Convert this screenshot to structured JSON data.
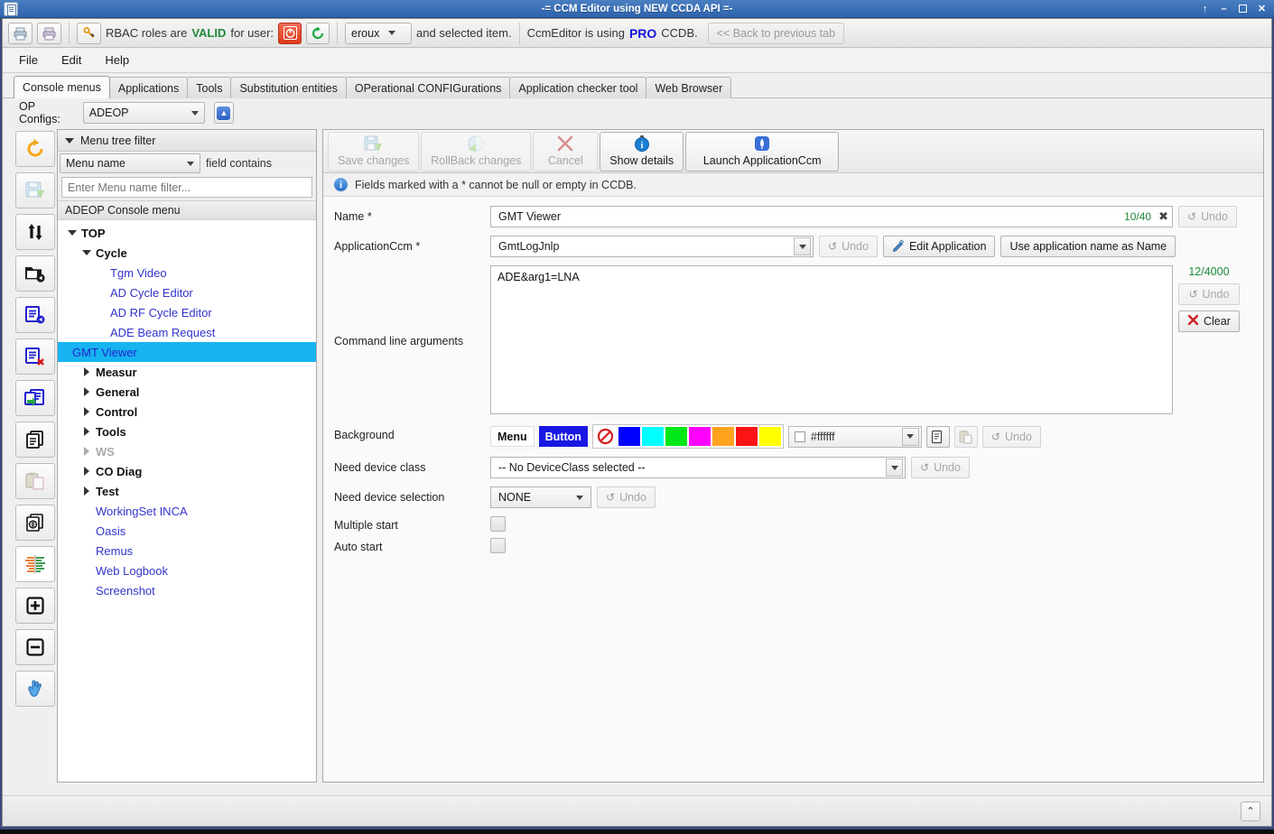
{
  "window": {
    "title": "-= CCM Editor using NEW CCDA API =-",
    "icon": "document-icon",
    "controls": [
      {
        "name": "roll-up-button",
        "glyph": "↑"
      },
      {
        "name": "minimize-button",
        "glyph": "–"
      },
      {
        "name": "maximize-button",
        "glyph": "□"
      },
      {
        "name": "close-button",
        "glyph": "✕"
      }
    ]
  },
  "rbac_bar": {
    "print_button": "print-icon",
    "print_preview_button": "print-preview-icon",
    "rbac_key_button": "rbac-key-icon",
    "text_prefix": "RBAC roles are",
    "status": "VALID",
    "for_user": "for user:",
    "logout_button": "power-off-icon",
    "refresh_button": "refresh-icon",
    "user": "eroux",
    "text_middle": "and selected item.",
    "text_app": "CcmEditor is using",
    "db_mode": "PRO",
    "text_suffix": "CCDB.",
    "back_button": "<< Back to previous tab"
  },
  "menubar": [
    "File",
    "Edit",
    "Help"
  ],
  "tabs": [
    {
      "label": "Console menus",
      "active": true
    },
    {
      "label": "Applications",
      "active": false
    },
    {
      "label": "Tools",
      "active": false
    },
    {
      "label": "Substitution entities",
      "active": false
    },
    {
      "label": "OPerational CONFIGurations",
      "active": false
    },
    {
      "label": "Application checker tool",
      "active": false
    },
    {
      "label": "Web Browser",
      "active": false
    }
  ],
  "opconfigs": {
    "label": "OP Configs:",
    "value": "ADEOP",
    "launch_button": "launch-app-icon"
  },
  "vtoolbar": [
    {
      "name": "reload-icon"
    },
    {
      "name": "save-disk-icon"
    },
    {
      "name": "move-updown-icon"
    },
    {
      "name": "new-folder-icon"
    },
    {
      "name": "add-entry-icon"
    },
    {
      "name": "delete-entry-icon"
    },
    {
      "name": "duplicate-entry-icon"
    },
    {
      "name": "copy-page-icon"
    },
    {
      "name": "paste-clipboard-icon"
    },
    {
      "name": "preview-pages-icon"
    },
    {
      "name": "compare-icon"
    },
    {
      "name": "expand-all-icon"
    },
    {
      "name": "collapse-all-icon"
    },
    {
      "name": "select-hand-icon"
    }
  ],
  "tree_panel": {
    "filter_header": "Menu tree filter",
    "filter_field": "Menu name",
    "field_contains": "field contains",
    "filter_placeholder": "Enter Menu name filter...",
    "tree_title": "ADEOP Console menu",
    "nodes": [
      {
        "label": "TOP",
        "depth": 0,
        "style": "bold",
        "arrow": "down"
      },
      {
        "label": "Cycle",
        "depth": 1,
        "style": "bold",
        "arrow": "down"
      },
      {
        "label": "Tgm Video",
        "depth": 2,
        "style": "link",
        "arrow": "none"
      },
      {
        "label": "AD Cycle  Editor",
        "depth": 2,
        "style": "link",
        "arrow": "none"
      },
      {
        "label": "AD RF Cycle Editor",
        "depth": 2,
        "style": "link",
        "arrow": "none"
      },
      {
        "label": "ADE Beam Request",
        "depth": 2,
        "style": "link",
        "arrow": "none"
      },
      {
        "label": "GMT Viewer",
        "depth": 2,
        "style": "selected",
        "arrow": "none"
      },
      {
        "label": "Measur",
        "depth": 1,
        "style": "bold",
        "arrow": "right"
      },
      {
        "label": "General",
        "depth": 1,
        "style": "bold",
        "arrow": "right"
      },
      {
        "label": "Control",
        "depth": 1,
        "style": "bold",
        "arrow": "right"
      },
      {
        "label": "Tools",
        "depth": 1,
        "style": "bold",
        "arrow": "right"
      },
      {
        "label": "WS",
        "depth": 1,
        "style": "dim",
        "arrow": "right-dim"
      },
      {
        "label": "CO Diag",
        "depth": 1,
        "style": "bold",
        "arrow": "right"
      },
      {
        "label": "Test",
        "depth": 1,
        "style": "bold",
        "arrow": "right"
      },
      {
        "label": "WorkingSet INCA",
        "depth": 1,
        "style": "link",
        "arrow": "none"
      },
      {
        "label": "Oasis",
        "depth": 1,
        "style": "link",
        "arrow": "none"
      },
      {
        "label": "Remus",
        "depth": 1,
        "style": "link",
        "arrow": "none"
      },
      {
        "label": "Web Logbook",
        "depth": 1,
        "style": "link",
        "arrow": "none"
      },
      {
        "label": "Screenshot",
        "depth": 1,
        "style": "link",
        "arrow": "none"
      }
    ]
  },
  "form_toolbar": [
    {
      "label": "Save changes",
      "icon": "save-icon",
      "enabled": false
    },
    {
      "label": "RollBack changes",
      "icon": "rollback-icon",
      "enabled": false
    },
    {
      "label": "Cancel",
      "icon": "cancel-x-icon",
      "enabled": false
    },
    {
      "label": "Show details",
      "icon": "info-clock-icon",
      "enabled": true
    },
    {
      "label": "Launch ApplicationCcm",
      "icon": "launch-app-icon",
      "enabled": true
    }
  ],
  "info_bar": {
    "icon": "info-icon",
    "text": "Fields marked with a * cannot be null or empty in CCDB."
  },
  "form": {
    "name": {
      "label": "Name *",
      "value": "GMT Viewer",
      "counter": "10/40",
      "clear_glyph": "✖",
      "undo_label": "Undo"
    },
    "application_ccm": {
      "label": "ApplicationCcm *",
      "value": "GmtLogJnlp",
      "undo_label": "Undo",
      "edit_label": "Edit Application",
      "use_name_label": "Use application name as Name"
    },
    "command_line": {
      "label": "Command line arguments",
      "value": "ADE&arg1=LNA",
      "counter": "12/4000",
      "undo_label": "Undo",
      "clear_label": "Clear"
    },
    "background": {
      "label": "Background",
      "menu_chip": "Menu",
      "button_chip": "Button",
      "swatches": [
        {
          "name": "no-color-swatch",
          "color": "none"
        },
        {
          "name": "blue-swatch",
          "color": "#0000ff"
        },
        {
          "name": "cyan-swatch",
          "color": "#00ffff"
        },
        {
          "name": "green-swatch",
          "color": "#00e817"
        },
        {
          "name": "magenta-swatch",
          "color": "#ff00ff"
        },
        {
          "name": "orange-swatch",
          "color": "#ffa21e"
        },
        {
          "name": "red-swatch",
          "color": "#fc1414"
        },
        {
          "name": "yellow-swatch",
          "color": "#ffff00"
        }
      ],
      "hex_value": "#ffffff",
      "copy_button": "copy-icon",
      "paste_button": "paste-icon",
      "undo_label": "Undo"
    },
    "need_device_class": {
      "label": "Need device class",
      "value": "-- No DeviceClass selected --",
      "undo_label": "Undo"
    },
    "need_device_selection": {
      "label": "Need device selection",
      "value": "NONE",
      "undo_label": "Undo"
    },
    "multiple_start": {
      "label": "Multiple start",
      "checked": false
    },
    "auto_start": {
      "label": "Auto start",
      "checked": false
    }
  },
  "statusbar": {
    "collapse_button": "collapse-up-icon",
    "collapse_glyph": "⌃"
  },
  "colors": {
    "title_bar": "#2f63ac",
    "selection": "#16b4f0",
    "link": "#3333cc",
    "valid_green": "#1f8a3b",
    "pro_blue": "#1414e0"
  }
}
